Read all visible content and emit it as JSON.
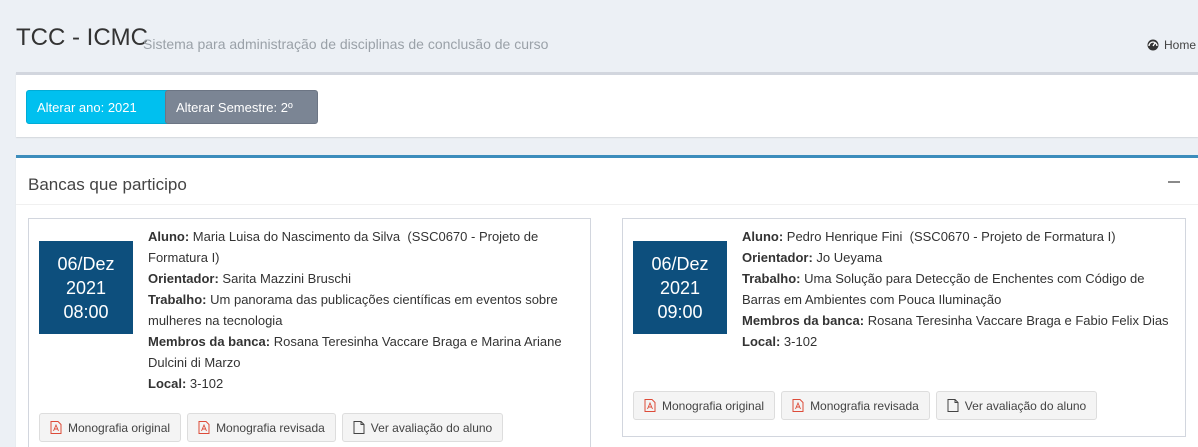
{
  "header": {
    "app_title": "TCC - ICMC",
    "subtitle": "Sistema para administração de disciplinas de conclusão de curso",
    "home_label": "Home"
  },
  "toolbar": {
    "year_button": "Alterar ano: 2021",
    "semester_button": "Alterar Semestre: 2º"
  },
  "panel": {
    "title": "Bancas que participo",
    "collapse_icon": "minus-icon"
  },
  "labels": {
    "aluno": "Aluno:",
    "orientador": "Orientador:",
    "trabalho": "Trabalho:",
    "membros": "Membros da banca:",
    "local": "Local:"
  },
  "bancas": [
    {
      "day_month": "06/Dez",
      "year": "2021",
      "time": "08:00",
      "aluno": "Maria Luisa do Nascimento da Silva",
      "disciplina": "(SSC0670 - Projeto de Formatura I)",
      "orientador": "Sarita Mazzini Bruschi",
      "trabalho": "Um panorama das publicações científicas em eventos sobre mulheres na tecnologia",
      "membros": "Rosana Teresinha Vaccare Braga e Marina Ariane Dulcini di Marzo",
      "local": "3-102",
      "actions": [
        "Monografia original",
        "Monografia revisada",
        "Ver avaliação do aluno"
      ]
    },
    {
      "day_month": "06/Dez",
      "year": "2021",
      "time": "09:00",
      "aluno": "Pedro Henrique Fini",
      "disciplina": "(SSC0670 - Projeto de Formatura I)",
      "orientador": "Jo Ueyama",
      "trabalho": "Uma Solução para Detecção de Enchentes com Código de Barras em Ambientes com Pouca Iluminação",
      "membros": "Rosana Teresinha Vaccare Braga e Fabio Felix Dias",
      "local": "3-102",
      "actions": [
        "Monografia original",
        "Monografia revisada",
        "Ver avaliação do aluno"
      ]
    }
  ],
  "colors": {
    "info": "#00c0ef",
    "gray": "#7b8594",
    "primary_border": "#3c8dbc",
    "date_bg": "#0d4f7d",
    "pdf_icon": "#dd4b39"
  }
}
